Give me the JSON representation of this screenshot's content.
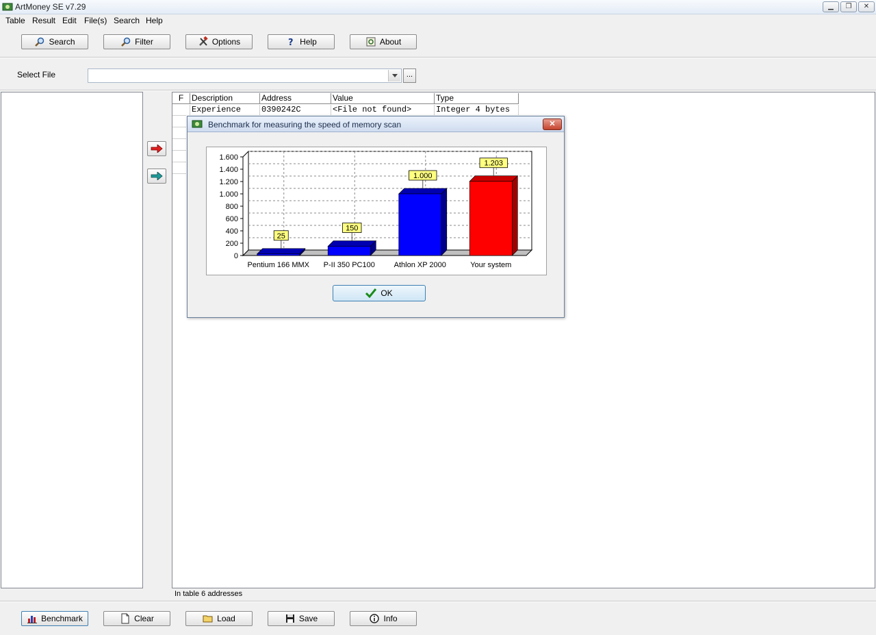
{
  "window": {
    "title": "ArtMoney SE v7.29"
  },
  "menu": [
    "Table",
    "Result",
    "Edit",
    "File(s)",
    "Search",
    "Help"
  ],
  "toolbar": [
    {
      "label": "Search",
      "icon": "search-icon"
    },
    {
      "label": "Filter",
      "icon": "filter-icon"
    },
    {
      "label": "Options",
      "icon": "tools-icon"
    },
    {
      "label": "Help",
      "icon": "help-icon"
    },
    {
      "label": "About",
      "icon": "about-icon"
    }
  ],
  "select_file": {
    "label": "Select File",
    "value": "",
    "browse_label": "..."
  },
  "table": {
    "columns": [
      "F",
      "Description",
      "Address",
      "Value",
      "Type"
    ],
    "rows": [
      {
        "f": "",
        "description": "Experience",
        "address": "0390242C",
        "value": "<File not found>",
        "type": "Integer 4 bytes"
      }
    ]
  },
  "status": "In table 6 addresses",
  "bottom_toolbar": [
    {
      "label": "Benchmark",
      "icon": "chart-icon"
    },
    {
      "label": "Clear",
      "icon": "page-icon"
    },
    {
      "label": "Load",
      "icon": "folder-icon"
    },
    {
      "label": "Save",
      "icon": "floppy-icon"
    },
    {
      "label": "Info",
      "icon": "info-icon"
    }
  ],
  "dialog": {
    "title": "Benchmark for measuring the speed of memory scan",
    "ok_label": "OK"
  },
  "chart_data": {
    "type": "bar",
    "categories": [
      "Pentium 166 MMX",
      "P-II 350 PC100",
      "Athlon XP 2000",
      "Your system"
    ],
    "values": [
      25,
      150,
      1000,
      1203
    ],
    "value_labels": [
      "25",
      "150",
      "1.000",
      "1.203"
    ],
    "colors": [
      "#0000ff",
      "#0000ff",
      "#0000ff",
      "#ff0000"
    ],
    "ylim": [
      0,
      1600
    ],
    "yticks": [
      0,
      200,
      400,
      600,
      800,
      1000,
      1200,
      1400,
      1600
    ],
    "ytick_labels": [
      "0",
      "200",
      "400",
      "600",
      "800",
      "1.000",
      "1.200",
      "1.400",
      "1.600"
    ],
    "grid": true,
    "style": "3d"
  }
}
